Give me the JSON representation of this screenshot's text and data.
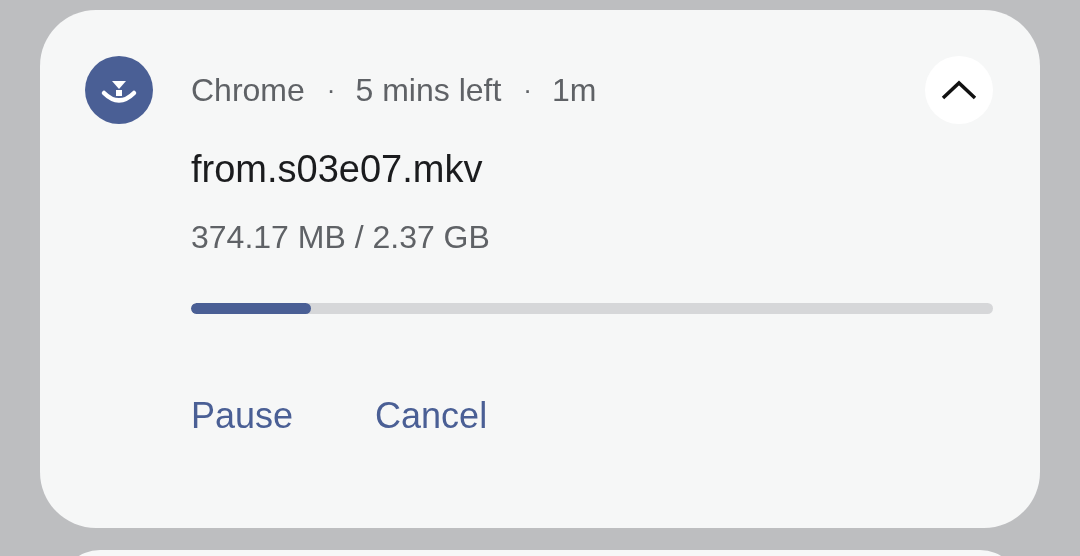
{
  "notification": {
    "app": "Chrome",
    "expanded": true,
    "details": [
      {
        "separator": "·",
        "text": "5 mins left"
      },
      {
        "separator": "·",
        "text": "1m"
      }
    ],
    "title": "from.s03e07.mkv",
    "size": "374.17 MB / 2.37 GB",
    "progress": {
      "level": 0.15
    },
    "actions": [
      "Pause",
      "Cancel"
    ]
  }
}
